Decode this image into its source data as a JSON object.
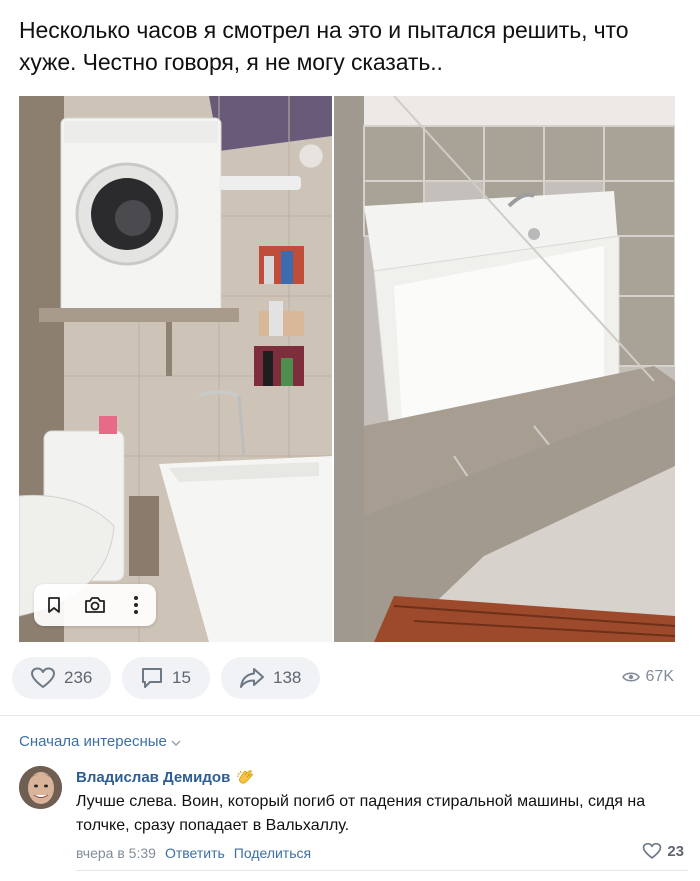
{
  "post": {
    "text": "Несколько часов я смотрел на это и пытался решить, что хуже. Честно говоря, я не могу сказать.."
  },
  "image_toolbar": {
    "bookmark_icon": "bookmark-icon",
    "camera_icon": "camera-search-icon",
    "more_icon": "more-vertical-icon"
  },
  "actions": {
    "likes": "236",
    "comments": "15",
    "shares": "138",
    "views": "67K"
  },
  "comments_section": {
    "sort_label": "Сначала интересные",
    "items": [
      {
        "author": "Владислав Демидов",
        "author_badge": "clapping-hands-emoji",
        "text": "Лучше слева. Воин, который погиб от падения стиральной машины, сидя на толчке, сразу попадает в Вальхаллу.",
        "date": "вчера в 5:39",
        "reply_label": "Ответить",
        "share_label": "Поделиться",
        "likes": "23"
      }
    ]
  },
  "colors": {
    "link": "#3d6fa3",
    "author": "#2f5f92",
    "muted": "#818c99",
    "pill_bg": "#f0f2f5"
  }
}
